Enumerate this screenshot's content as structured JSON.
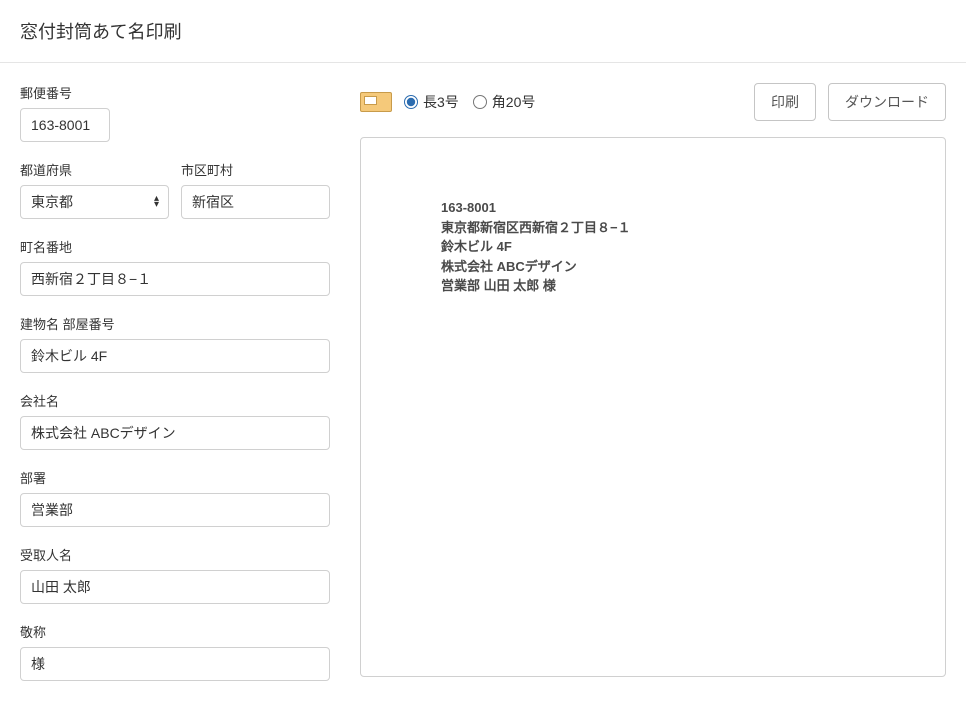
{
  "header": {
    "title": "窓付封筒あて名印刷"
  },
  "form": {
    "postalCode": {
      "label": "郵便番号",
      "value": "163-8001"
    },
    "prefecture": {
      "label": "都道府県",
      "value": "東京都"
    },
    "city": {
      "label": "市区町村",
      "value": "新宿区"
    },
    "street": {
      "label": "町名番地",
      "value": "西新宿２丁目８−１"
    },
    "building": {
      "label": "建物名 部屋番号",
      "value": "鈴木ビル 4F"
    },
    "company": {
      "label": "会社名",
      "value": "株式会社 ABCデザイン"
    },
    "department": {
      "label": "部署",
      "value": "営業部"
    },
    "recipient": {
      "label": "受取人名",
      "value": "山田 太郎"
    },
    "honorific": {
      "label": "敬称",
      "value": "様"
    }
  },
  "toolbar": {
    "sizeOptions": {
      "option1": {
        "label": "長3号",
        "value": "naga3",
        "checked": true
      },
      "option2": {
        "label": "角20号",
        "value": "kaku20",
        "checked": false
      }
    },
    "printButton": "印刷",
    "downloadButton": "ダウンロード"
  },
  "preview": {
    "line1": "163-8001",
    "line2": "東京都新宿区西新宿２丁目８−１",
    "line3": "鈴木ビル 4F",
    "line4": "株式会社 ABCデザイン",
    "line5": "営業部 山田 太郎 様"
  }
}
